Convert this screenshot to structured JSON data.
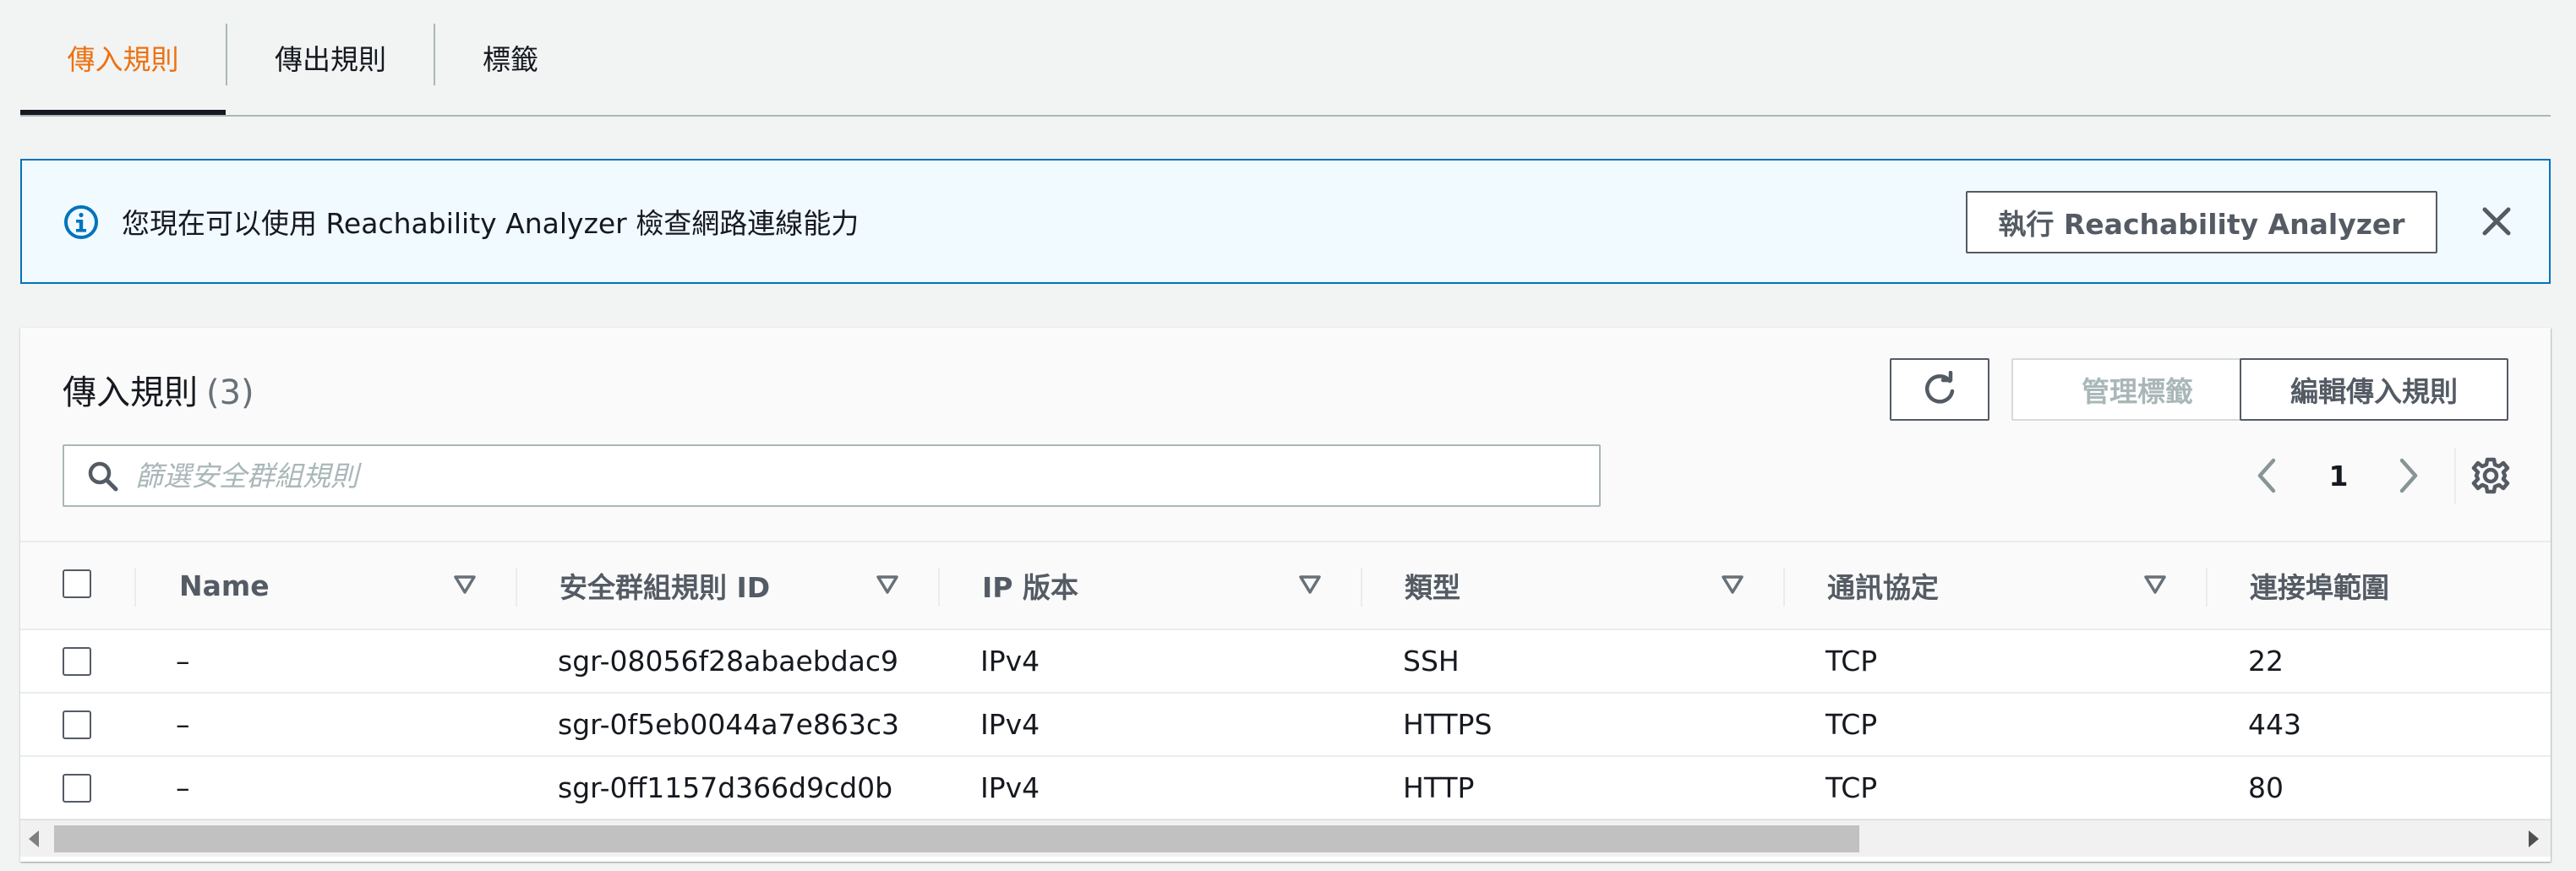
{
  "tabs": [
    {
      "label": "傳入規則",
      "active": true
    },
    {
      "label": "傳出規則",
      "active": false
    },
    {
      "label": "標籤",
      "active": false
    }
  ],
  "flash": {
    "message": "您現在可以使用 Reachability Analyzer 檢查網路連線能力",
    "action_label": "執行 Reachability Analyzer",
    "icon": "info-icon",
    "accent_color": "#0073bb"
  },
  "container": {
    "title": "傳入規則",
    "count": "(3)",
    "refresh_icon": "refresh-icon",
    "manage_tags_label": "管理標籤",
    "edit_rules_label": "編輯傳入規則",
    "search_placeholder": "篩選安全群組規則",
    "search_value": "",
    "page": "1"
  },
  "table": {
    "columns": [
      "Name",
      "安全群組規則 ID",
      "IP 版本",
      "類型",
      "通訊協定",
      "連接埠範圍"
    ],
    "rows": [
      {
        "name": "–",
        "rule_id": "sgr-08056f28abaebdac9",
        "ip_version": "IPv4",
        "type": "SSH",
        "protocol": "TCP",
        "port_range": "22"
      },
      {
        "name": "–",
        "rule_id": "sgr-0f5eb0044a7e863c3",
        "ip_version": "IPv4",
        "type": "HTTPS",
        "protocol": "TCP",
        "port_range": "443"
      },
      {
        "name": "–",
        "rule_id": "sgr-0ff1157d366d9cd0b",
        "ip_version": "IPv4",
        "type": "HTTP",
        "protocol": "TCP",
        "port_range": "80"
      }
    ]
  },
  "colors": {
    "active_tab": "#ec7211",
    "text": "#16191f",
    "secondary_text": "#545b64"
  }
}
